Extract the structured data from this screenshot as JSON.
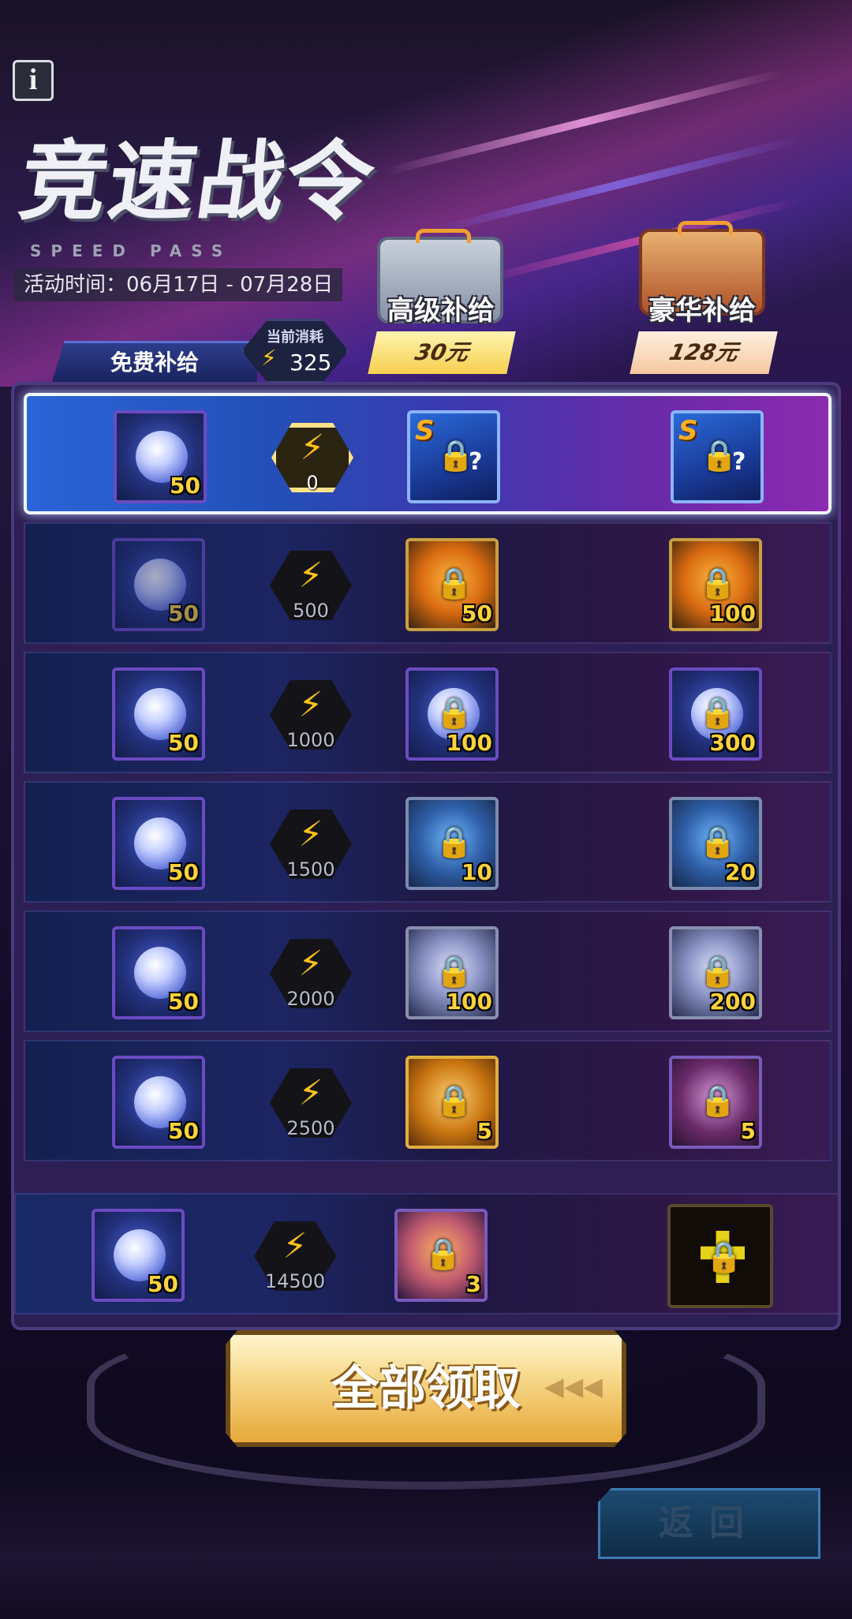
{
  "header": {
    "info_label": "i",
    "title": "竞速战令",
    "subtitle": "SPEED PASS",
    "activity_time": "活动时间：06月17日 - 07月28日"
  },
  "tiers": {
    "free_label": "免费补给",
    "current_cost_label": "当前消耗",
    "current_cost_value": "325",
    "advanced": {
      "label": "高级补给",
      "price": "30元"
    },
    "luxury": {
      "label": "豪华补给",
      "price": "128元"
    }
  },
  "rows": [
    {
      "threshold": "0",
      "free_qty": "50",
      "adv_qty": "",
      "lux_qty": ""
    },
    {
      "threshold": "500",
      "free_qty": "50",
      "adv_qty": "50",
      "lux_qty": "100"
    },
    {
      "threshold": "1000",
      "free_qty": "50",
      "adv_qty": "100",
      "lux_qty": "300"
    },
    {
      "threshold": "1500",
      "free_qty": "50",
      "adv_qty": "10",
      "lux_qty": "20"
    },
    {
      "threshold": "2000",
      "free_qty": "50",
      "adv_qty": "100",
      "lux_qty": "200"
    },
    {
      "threshold": "2500",
      "free_qty": "50",
      "adv_qty": "5",
      "lux_qty": "5"
    },
    {
      "threshold": "14500",
      "free_qty": "50",
      "adv_qty": "3",
      "lux_qty": ""
    }
  ],
  "actions": {
    "claim_all": "全部领取",
    "return": "返回"
  },
  "icons": {
    "energy": "lightning-bolt",
    "lock": "padlock",
    "mystery": "s-rank-mystery-box"
  },
  "colors": {
    "accent_gold": "#ffd23a",
    "energy": "#ffc21a",
    "panel": "#2d1f54"
  }
}
